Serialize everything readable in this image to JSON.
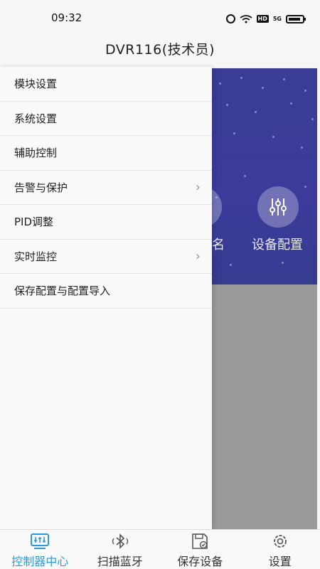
{
  "status_bar": {
    "time": "09:32",
    "icons": [
      "alarm-icon",
      "wifi-icon",
      "hd-icon",
      "5g-signal-icon",
      "battery-icon"
    ],
    "network_label": "5G",
    "hd_label": "HD"
  },
  "header": {
    "title": "DVR116(技术员)"
  },
  "background": {
    "config_label": "设备配置",
    "partial_label": "名",
    "banner_color": "#3a3c96"
  },
  "drawer": {
    "items": [
      {
        "label": "模块设置",
        "has_submenu": false
      },
      {
        "label": "系统设置",
        "has_submenu": false
      },
      {
        "label": "辅助控制",
        "has_submenu": false
      },
      {
        "label": "告警与保护",
        "has_submenu": true
      },
      {
        "label": "PID调整",
        "has_submenu": false
      },
      {
        "label": "实时监控",
        "has_submenu": true
      },
      {
        "label": "保存配置与配置导入",
        "has_submenu": false
      }
    ]
  },
  "bottom_nav": {
    "active_color": "#2b9cd8",
    "items": [
      {
        "label": "控制器中心",
        "icon": "control-center-icon",
        "active": true
      },
      {
        "label": "扫描蓝牙",
        "icon": "bluetooth-icon",
        "active": false
      },
      {
        "label": "保存设备",
        "icon": "save-device-icon",
        "active": false
      },
      {
        "label": "设置",
        "icon": "settings-gear-icon",
        "active": false
      }
    ]
  }
}
